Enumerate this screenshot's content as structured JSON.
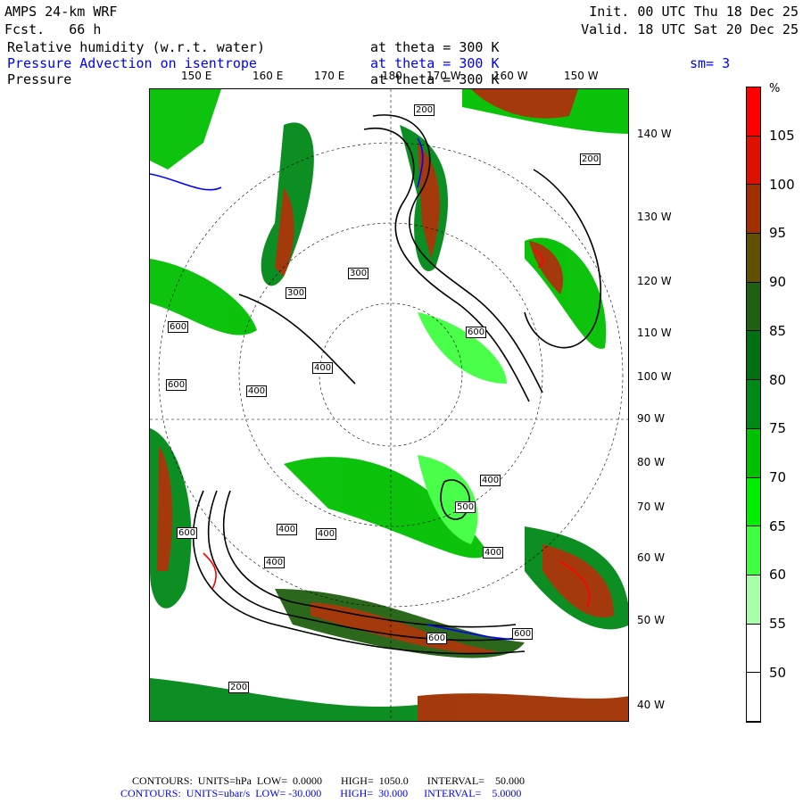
{
  "header": {
    "model": "AMPS 24-km WRF",
    "forecast": "Fcst.   66 h",
    "init": "Init. 00 UTC Thu 18 Dec 25",
    "valid": "Valid. 18 UTC Sat 20 Dec 25",
    "fields": [
      {
        "name": "Relative humidity (w.r.t. water)",
        "level": "at theta = 300 K",
        "color": "#000000"
      },
      {
        "name": "Pressure Advection on isentrope",
        "level": "at theta = 300 K",
        "extra": "sm= 3",
        "color": "#0000ff"
      },
      {
        "name": "Pressure",
        "level": "at theta = 300 K",
        "color": "#000000"
      }
    ]
  },
  "map": {
    "top_lon_labels": [
      "150 E",
      "160 E",
      "170 E",
      "180",
      "170 W",
      "160 W",
      "150 W"
    ],
    "right_lon_labels": [
      "140 W",
      "130 W",
      "120 W",
      "110 W",
      "100 W",
      "90 W",
      "80 W",
      "70 W",
      "60 W",
      "50 W",
      "40 W"
    ],
    "contour_labels": [
      "200",
      "200",
      "300",
      "300",
      "600",
      "600",
      "400",
      "400",
      "400",
      "400",
      "400",
      "400",
      "400",
      "500",
      "600",
      "600",
      "600",
      "600",
      "200"
    ]
  },
  "colorbar": {
    "unit": "%",
    "labels": [
      "105",
      "100",
      "95",
      "90",
      "85",
      "80",
      "75",
      "70",
      "65",
      "60",
      "55",
      "50"
    ],
    "colors": [
      "#ff0000",
      "#dd1100",
      "#a03000",
      "#605000",
      "#206010",
      "#007010",
      "#008818",
      "#00c000",
      "#00ee00",
      "#40ff40",
      "#a8ffa8",
      "#ffffff",
      "#ffffff"
    ]
  },
  "footer": {
    "line1": "CONTOURS:  UNITS=hPa  LOW=  0.0000       HIGH=  1050.0       INTERVAL=    50.000",
    "line2": "CONTOURS:  UNITS=ubar/s  LOW= -30.000       HIGH=  30.000      INTERVAL=    5.0000"
  }
}
